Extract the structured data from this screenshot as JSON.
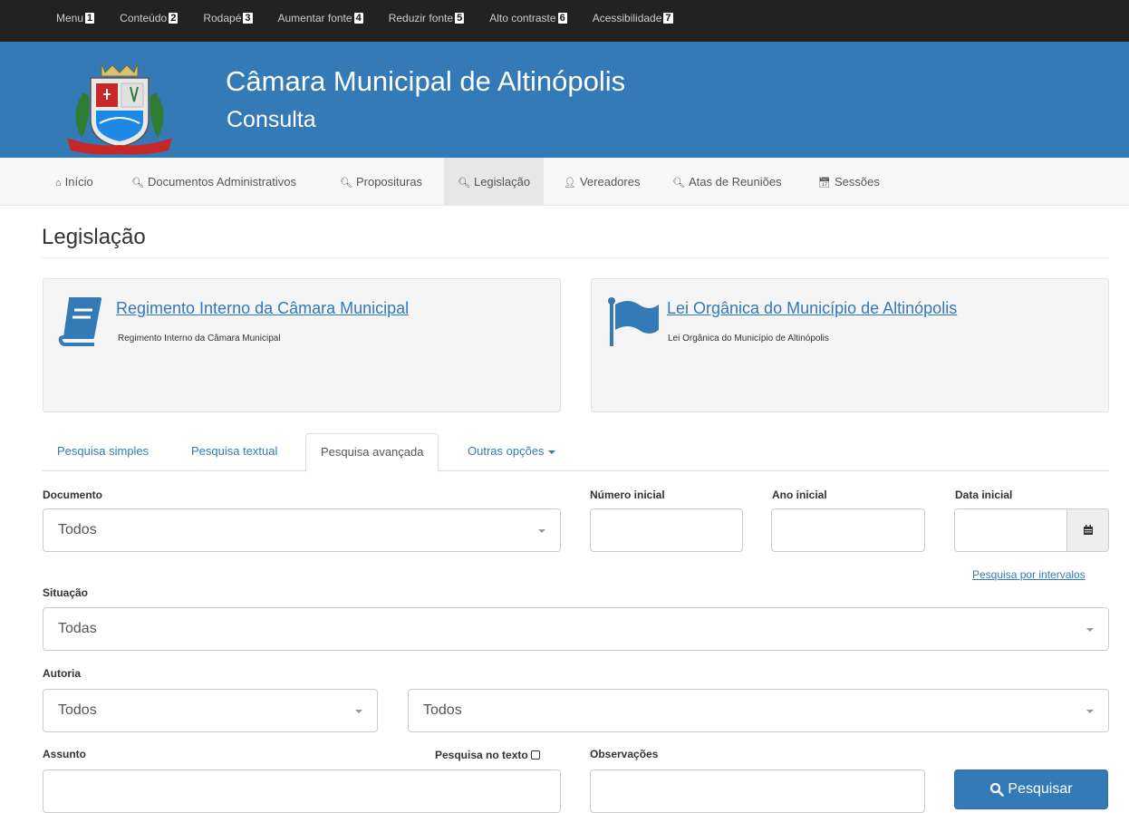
{
  "accessibility_bar": {
    "items": [
      {
        "label": "Menu",
        "key": "1"
      },
      {
        "label": "Conteúdo",
        "key": "2"
      },
      {
        "label": "Rodapé",
        "key": "3"
      },
      {
        "label": "Aumentar fonte",
        "key": "4"
      },
      {
        "label": "Reduzir fonte",
        "key": "5"
      },
      {
        "label": "Alto contraste",
        "key": "6"
      },
      {
        "label": "Acessibilidade",
        "key": "7"
      }
    ]
  },
  "header": {
    "title": "Câmara Municipal de Altinópolis",
    "subtitle": "Consulta",
    "background_color": "#337ab7"
  },
  "nav": {
    "items": [
      {
        "label": "Início",
        "icon": "home-icon",
        "glyph": "🏠︎"
      },
      {
        "label": "Documentos Administrativos",
        "icon": "search-icon",
        "glyph": ""
      },
      {
        "label": "Proposituras",
        "icon": "search-icon",
        "glyph": ""
      },
      {
        "label": "Legislação",
        "icon": "search-icon",
        "glyph": "",
        "active": true
      },
      {
        "label": "Vereadores",
        "icon": "user-icon",
        "glyph": ""
      },
      {
        "label": "Atas de Reuniões",
        "icon": "search-icon",
        "glyph": ""
      },
      {
        "label": "Sessões",
        "icon": "calendar-icon",
        "glyph": ""
      }
    ]
  },
  "page": {
    "title": "Legislação"
  },
  "cards": [
    {
      "icon": "book-icon",
      "link": "Regimento Interno da Câmara Municipal",
      "description": "Regimento Interno da Câmara Municipal"
    },
    {
      "icon": "flag-icon",
      "link": "Lei Orgânica do Município de Altinópolis",
      "description": "Lei Orgânica do Município de Altinópolis"
    }
  ],
  "tabs": {
    "items": [
      {
        "label": "Pesquisa simples"
      },
      {
        "label": "Pesquisa textual"
      },
      {
        "label": "Pesquisa avançada",
        "active": true
      },
      {
        "label": "Outras opções"
      }
    ]
  },
  "form": {
    "documento": {
      "label": "Documento",
      "value": "Todos"
    },
    "numero_inicial": {
      "label": "Número inicial",
      "value": ""
    },
    "ano_inicial": {
      "label": "Ano inicial",
      "value": ""
    },
    "data_inicial": {
      "label": "Data inicial",
      "value": ""
    },
    "intervalos_link": "Pesquisa por intervalos",
    "situacao": {
      "label": "Situação",
      "value": "Todas"
    },
    "autoria": {
      "label": "Autoria",
      "value1": "Todos",
      "value2": "Todos"
    },
    "assunto": {
      "label": "Assunto",
      "value": ""
    },
    "pesquisa_no_texto": {
      "label": "Pesquisa no texto",
      "checked": false
    },
    "observacoes": {
      "label": "Observações",
      "value": ""
    },
    "submit_label": "Pesquisar"
  }
}
